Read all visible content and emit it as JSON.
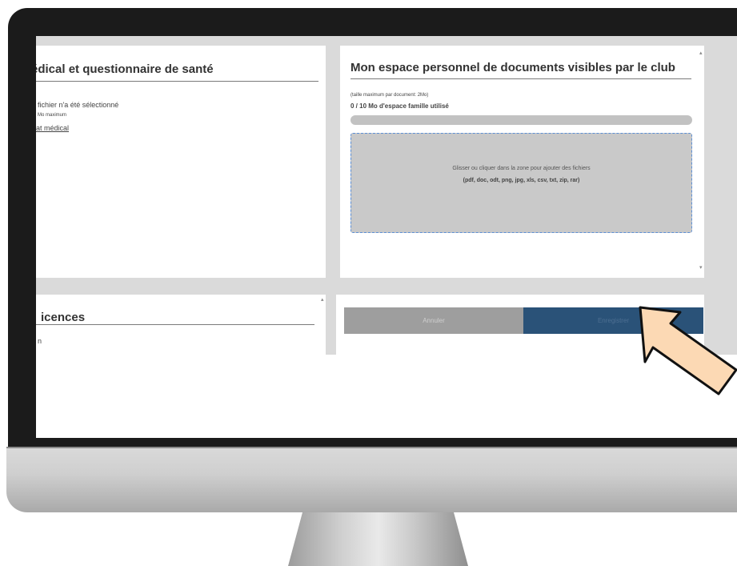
{
  "left_top_panel": {
    "title": "édical et questionnaire de santé",
    "no_file": "fichier n'a été sélectionné",
    "size_note": "Mo maximum",
    "link": "at médical"
  },
  "right_top_panel": {
    "title": "Mon espace personnel de documents visibles par le club",
    "max_size": "(taille maximum par document: 2Mo)",
    "usage": "0 / 10 Mo d'espace famille utilisé",
    "usage_fraction": 0,
    "dropzone_text": "Glisser ou cliquer dans la zone pour ajouter des fichiers",
    "dropzone_types": "(pdf, doc, odt, png, jpg, xls, csv, txt, zip, rar)"
  },
  "left_bottom_panel": {
    "title": "icences",
    "fragment": "n"
  },
  "buttons": {
    "cancel": "Annuler",
    "save": "Enregistrer"
  },
  "colors": {
    "save_button": "#2a5278",
    "cancel_button": "#9e9e9e",
    "dropzone_border": "#5b8fd6",
    "arrow_fill": "#fcd9b4"
  },
  "icons": [
    "pointer-arrow-icon"
  ]
}
